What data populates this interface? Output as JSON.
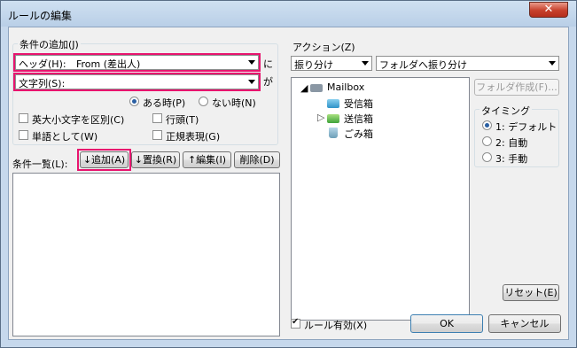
{
  "window": {
    "title": "ルールの編集",
    "close_glyph": "✕"
  },
  "conditions": {
    "group_label": "条件の追加(J)",
    "header_combo": {
      "label": "ヘッダ(H):",
      "value": "From (差出人)"
    },
    "header_suffix": "に",
    "string_combo": {
      "label": "文字列(S):",
      "value": ""
    },
    "string_suffix": "が",
    "radio_exists": "ある時(P)",
    "radio_not_exists": "ない時(N)",
    "selected_radio": "exists",
    "check_case": "英大小文字を区別(C)",
    "check_line_start": "行頭(T)",
    "check_word": "単語として(W)",
    "check_regex": "正規表現(G)"
  },
  "list": {
    "label": "条件一覧(L):",
    "add": "↓追加(A)",
    "replace": "↓置換(R)",
    "edit": "↑編集(I)",
    "delete": "削除(D)"
  },
  "action": {
    "group_label": "アクション(Z)",
    "action_combo": "振り分け",
    "target_combo": "フォルダへ振り分け",
    "create_folder": "フォルダ作成(F)...",
    "tree": {
      "root": "Mailbox",
      "items": [
        "受信箱",
        "送信箱",
        "ごみ箱"
      ]
    }
  },
  "timing": {
    "label": "タイミング",
    "options": [
      "1: デフォルト",
      "2: 自動",
      "3: 手動"
    ],
    "selected": 0,
    "reset": "リセット(E)"
  },
  "footer": {
    "rule_enabled": "ルール有効(X)",
    "rule_enabled_checked": true,
    "ok": "OK",
    "cancel": "キャンセル"
  },
  "colors": {
    "highlight": "#e8146e",
    "titlebar": "#c6d8ec",
    "close": "#c7402c"
  }
}
